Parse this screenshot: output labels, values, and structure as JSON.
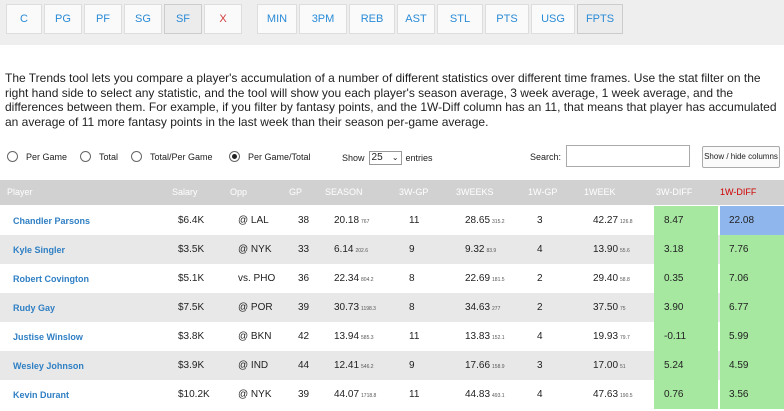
{
  "positions": [
    "C",
    "PG",
    "PF",
    "SG",
    "SF",
    "X"
  ],
  "stats": [
    "MIN",
    "3PM",
    "REB",
    "AST",
    "STL",
    "PTS",
    "USG",
    "FPTS"
  ],
  "description": "The Trends tool lets you compare a player's accumulation of a number of different statistics over different time frames. Use the stat filter on the right hand side to select any statistic, and the tool will show you each player's season average, 3 week average, 1 week average, and the differences between them. For example, if you filter by fantasy points, and the 1W-Diff column has an 11, that means that player has accumulated an average of 11 more fantasy points in the last week than their season per-game average.",
  "radios": [
    "Per Game",
    "Total",
    "Total/Per Game",
    "Per Game/Total"
  ],
  "selected_radio": "Per Game/Total",
  "show": {
    "label": "Show",
    "value": "25",
    "suffix": "entries"
  },
  "search": {
    "label": "Search:",
    "value": ""
  },
  "show_hide_label": "Show / hide columns",
  "columns": [
    "Player",
    "Salary",
    "Opp",
    "GP",
    "SEASON",
    "3W-GP",
    "3WEEKS",
    "1W-GP",
    "1WEEK",
    "3W-DIFF",
    "1W-DIFF"
  ],
  "rows": [
    {
      "player": "Chandler Parsons",
      "salary": "$6.4K",
      "opp": "@ LAL",
      "gp": "38",
      "season": "20.18",
      "season_sub": "767",
      "gp3w": "11",
      "weeks3": "28.65",
      "weeks3_sub": "315.2",
      "gp1w": "3",
      "week1": "42.27",
      "week1_sub": "126.8",
      "diff3": "8.47",
      "diff1": "22.08"
    },
    {
      "player": "Kyle Singler",
      "salary": "$3.5K",
      "opp": "@ NYK",
      "gp": "33",
      "season": "6.14",
      "season_sub": "202.6",
      "gp3w": "9",
      "weeks3": "9.32",
      "weeks3_sub": "83.9",
      "gp1w": "4",
      "week1": "13.90",
      "week1_sub": "55.6",
      "diff3": "3.18",
      "diff1": "7.76"
    },
    {
      "player": "Robert Covington",
      "salary": "$5.1K",
      "opp": "vs. PHO",
      "gp": "36",
      "season": "22.34",
      "season_sub": "804.2",
      "gp3w": "8",
      "weeks3": "22.69",
      "weeks3_sub": "181.5",
      "gp1w": "2",
      "week1": "29.40",
      "week1_sub": "58.8",
      "diff3": "0.35",
      "diff1": "7.06"
    },
    {
      "player": "Rudy Gay",
      "salary": "$7.5K",
      "opp": "@ POR",
      "gp": "39",
      "season": "30.73",
      "season_sub": "1198.3",
      "gp3w": "8",
      "weeks3": "34.63",
      "weeks3_sub": "277",
      "gp1w": "2",
      "week1": "37.50",
      "week1_sub": "75",
      "diff3": "3.90",
      "diff1": "6.77"
    },
    {
      "player": "Justise Winslow",
      "salary": "$3.8K",
      "opp": "@ BKN",
      "gp": "42",
      "season": "13.94",
      "season_sub": "585.3",
      "gp3w": "11",
      "weeks3": "13.83",
      "weeks3_sub": "152.1",
      "gp1w": "4",
      "week1": "19.93",
      "week1_sub": "79.7",
      "diff3": "-0.11",
      "diff1": "5.99"
    },
    {
      "player": "Wesley Johnson",
      "salary": "$3.9K",
      "opp": "@ IND",
      "gp": "44",
      "season": "12.41",
      "season_sub": "546.2",
      "gp3w": "9",
      "weeks3": "17.66",
      "weeks3_sub": "158.9",
      "gp1w": "3",
      "week1": "17.00",
      "week1_sub": "51",
      "diff3": "5.24",
      "diff1": "4.59"
    },
    {
      "player": "Kevin Durant",
      "salary": "$10.2K",
      "opp": "@ NYK",
      "gp": "39",
      "season": "44.07",
      "season_sub": "1718.8",
      "gp3w": "11",
      "weeks3": "44.83",
      "weeks3_sub": "493.1",
      "gp1w": "4",
      "week1": "47.63",
      "week1_sub": "190.5",
      "diff3": "0.76",
      "diff1": "3.56"
    }
  ],
  "colors": {
    "accent": "#2a8bd6",
    "diff_green": "#a6e8a0",
    "highlight_blue": "#8fb7ee",
    "header_gray": "#d1d1d1",
    "red": "#d00000"
  }
}
